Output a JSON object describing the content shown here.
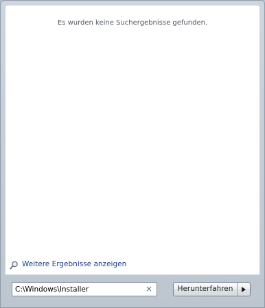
{
  "results": {
    "empty_message": "Es wurden keine Suchergebnisse gefunden.",
    "more_results_label": "Weitere Ergebnisse anzeigen"
  },
  "search": {
    "value": "C:\\Windows\\Installer",
    "clear_glyph": "×"
  },
  "power": {
    "shutdown_label": "Herunterfahren",
    "arrow_icon": "triangle-right"
  },
  "icons": {
    "more_results": "magnifier-icon"
  }
}
